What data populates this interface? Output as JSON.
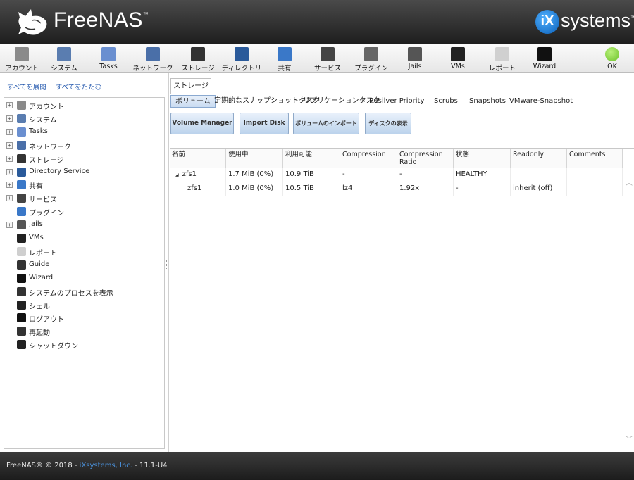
{
  "header": {
    "app_name": "FreeNAS",
    "tm": "™",
    "vendor_ix": "iX",
    "vendor_systems": "systems",
    "vendor_tm": "™"
  },
  "toolbar": {
    "items": [
      {
        "label": "アカウント",
        "icon": "accounts-icon",
        "color": "#8a8a8a"
      },
      {
        "label": "システム",
        "icon": "system-icon",
        "color": "#5a7db0"
      },
      {
        "label": "Tasks",
        "icon": "tasks-icon",
        "color": "#6a8fd0"
      },
      {
        "label": "ネットワーク",
        "icon": "network-icon",
        "color": "#4a6fa8"
      },
      {
        "label": "ストレージ",
        "icon": "storage-icon",
        "color": "#333333"
      },
      {
        "label": "ディレクトリ",
        "icon": "directory-icon",
        "color": "#2a5a9a"
      },
      {
        "label": "共有",
        "icon": "sharing-icon",
        "color": "#3a78c8"
      },
      {
        "label": "サービス",
        "icon": "services-icon",
        "color": "#444444"
      },
      {
        "label": "プラグイン",
        "icon": "plugins-icon",
        "color": "#666666"
      },
      {
        "label": "Jails",
        "icon": "jails-icon",
        "color": "#555555"
      },
      {
        "label": "VMs",
        "icon": "vms-icon",
        "color": "#222222"
      },
      {
        "label": "レポート",
        "icon": "reporting-icon",
        "color": "#d0d0d0"
      },
      {
        "label": "Wizard",
        "icon": "wizard-icon",
        "color": "#111111"
      }
    ],
    "status_label": "OK",
    "status_color": "#6cc12a"
  },
  "left": {
    "expand_all": "すべてを展開",
    "collapse_all": "すべてをたたむ",
    "tree": [
      {
        "label": "アカウント",
        "icon": "accounts-icon",
        "expandable": true,
        "color": "#8a8a8a"
      },
      {
        "label": "システム",
        "icon": "system-icon",
        "expandable": true,
        "color": "#5a7db0"
      },
      {
        "label": "Tasks",
        "icon": "tasks-icon",
        "expandable": true,
        "color": "#6a8fd0"
      },
      {
        "label": "ネットワーク",
        "icon": "network-icon",
        "expandable": true,
        "color": "#4a6fa8"
      },
      {
        "label": "ストレージ",
        "icon": "storage-icon",
        "expandable": true,
        "color": "#333333"
      },
      {
        "label": "Directory Service",
        "icon": "directory-icon",
        "expandable": true,
        "color": "#2a5a9a"
      },
      {
        "label": "共有",
        "icon": "sharing-icon",
        "expandable": true,
        "color": "#3a78c8"
      },
      {
        "label": "サービス",
        "icon": "services-icon",
        "expandable": true,
        "color": "#444444"
      },
      {
        "label": "プラグイン",
        "icon": "plugins-icon",
        "expandable": false,
        "color": "#3a78c8"
      },
      {
        "label": "Jails",
        "icon": "jails-icon",
        "expandable": true,
        "color": "#555555"
      },
      {
        "label": "VMs",
        "icon": "vms-icon",
        "expandable": false,
        "color": "#222222"
      },
      {
        "label": "レポート",
        "icon": "reporting-icon",
        "expandable": false,
        "color": "#cfcfcf"
      },
      {
        "label": "Guide",
        "icon": "guide-icon",
        "expandable": false,
        "color": "#333333"
      },
      {
        "label": "Wizard",
        "icon": "wizard-icon",
        "expandable": false,
        "color": "#111111"
      },
      {
        "label": "システムのプロセスを表示",
        "icon": "processes-icon",
        "expandable": false,
        "color": "#333333"
      },
      {
        "label": "シェル",
        "icon": "shell-icon",
        "expandable": false,
        "color": "#222222"
      },
      {
        "label": "ログアウト",
        "icon": "logout-icon",
        "expandable": false,
        "color": "#111111"
      },
      {
        "label": "再起動",
        "icon": "reboot-icon",
        "expandable": false,
        "color": "#333333"
      },
      {
        "label": "シャットダウン",
        "icon": "shutdown-icon",
        "expandable": false,
        "color": "#222222"
      }
    ]
  },
  "main": {
    "tab": "ストレージ",
    "subtabs": [
      "ボリューム",
      "定期的なスナップショットタスク",
      "リプリケーションタスク",
      "Resilver Priority",
      "Scrubs",
      "Snapshots",
      "VMware-Snapshot"
    ],
    "buttons": [
      "Volume Manager",
      "Import Disk",
      "ボリュームのインポート",
      "ディスクの表示"
    ],
    "columns": [
      "名前",
      "使用中",
      "利用可能",
      "Compression",
      "Compression Ratio",
      "状態",
      "Readonly",
      "Comments"
    ],
    "rows": [
      {
        "expander": "◢",
        "name": "zfs1",
        "used": "1.7 MiB (0%)",
        "available": "10.9 TiB",
        "compression": "-",
        "ratio": "-",
        "status": "HEALTHY",
        "readonly": "",
        "comments": ""
      },
      {
        "expander": "",
        "name": "zfs1",
        "used": "1.0 MiB (0%)",
        "available": "10.5 TiB",
        "compression": "lz4",
        "ratio": "1.92x",
        "status": "-",
        "readonly": "inherit (off)",
        "comments": ""
      }
    ]
  },
  "footer": {
    "prefix": "FreeNAS® © 2018 - ",
    "link": "iXsystems, Inc.",
    "suffix": " - 11.1-U4"
  }
}
